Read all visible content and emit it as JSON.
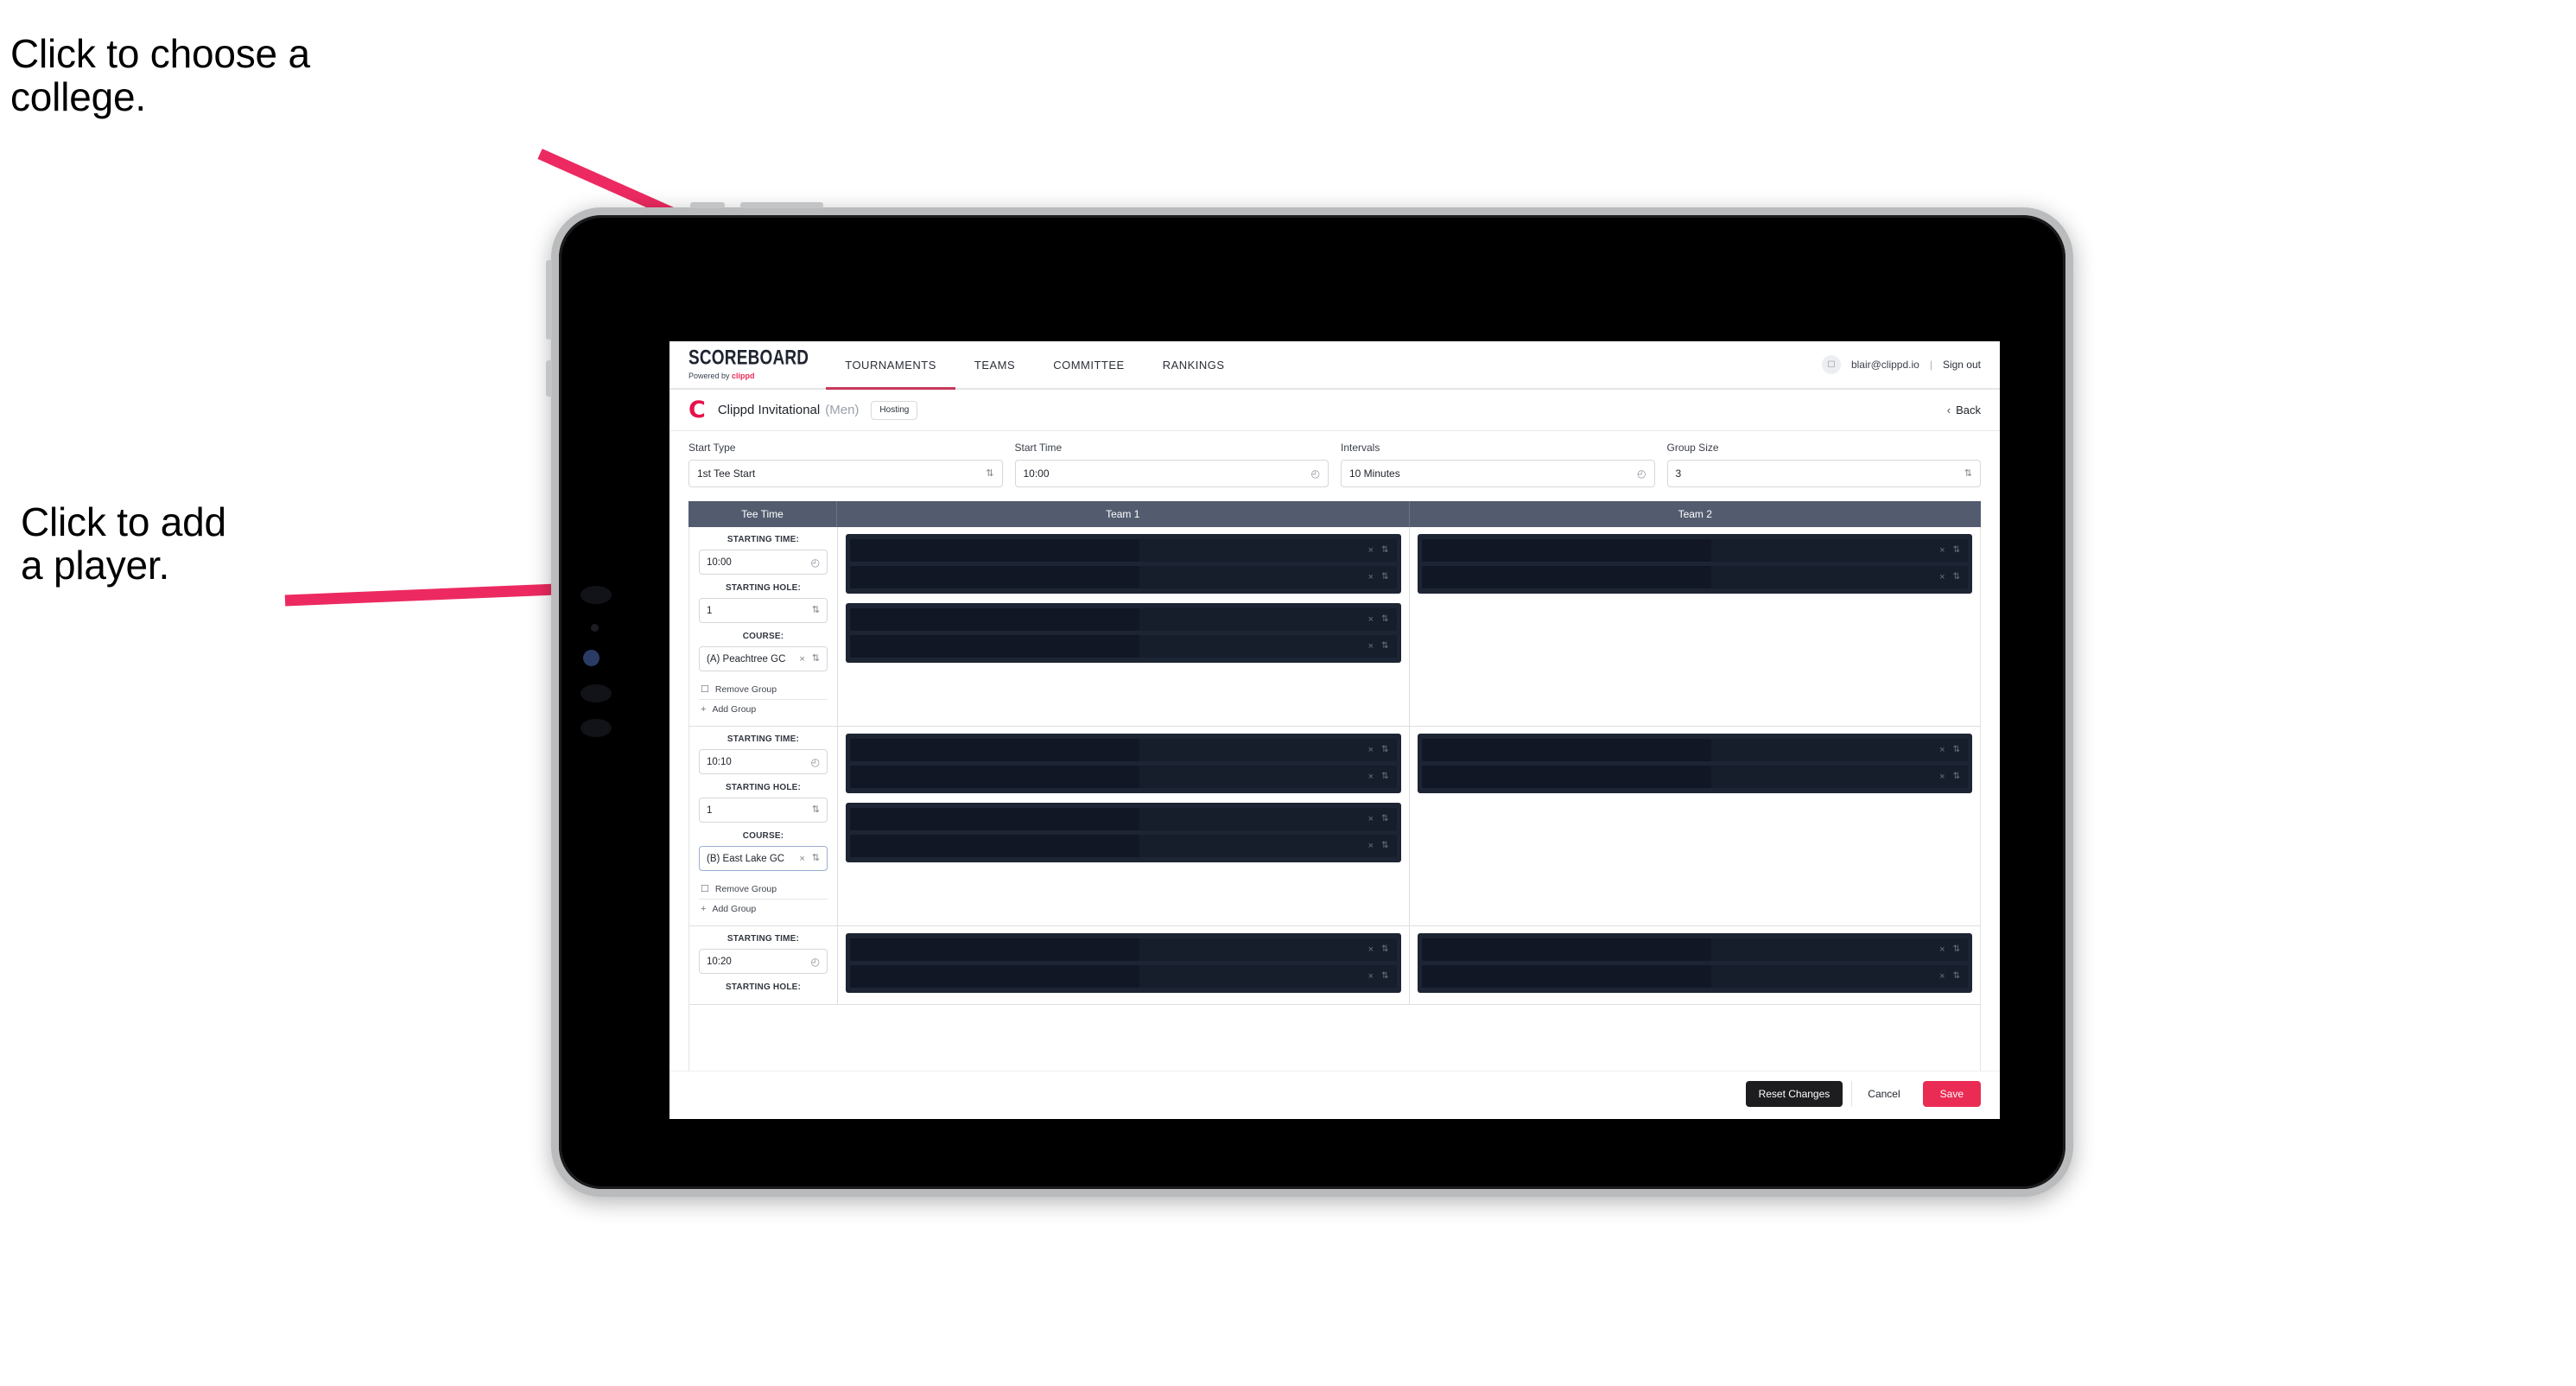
{
  "annotations": [
    {
      "id": "college",
      "text": "Click to choose a\ncollege."
    },
    {
      "id": "player",
      "text": "Click to add\na player."
    }
  ],
  "colors": {
    "accent_pink": "#ea2c55",
    "arrow_pink": "#ec2a61",
    "nav_underline": "#c8395c",
    "table_header_bg": "#535c6f",
    "player_block_bg": "#1d2534",
    "dark_button": "#1d1d20"
  },
  "topnav": {
    "brand_title": "SCOREBOARD",
    "brand_sub_prefix": "Powered by ",
    "brand_sub_name": "clippd",
    "tabs": [
      {
        "label": "TOURNAMENTS",
        "active": true
      },
      {
        "label": "TEAMS",
        "active": false
      },
      {
        "label": "COMMITTEE",
        "active": false
      },
      {
        "label": "RANKINGS",
        "active": false
      }
    ],
    "avatar_icon": "user-avatar-icon",
    "user_email": "blair@clippd.io",
    "separator": "|",
    "sign_out": "Sign out"
  },
  "breadcrumb": {
    "logo_letter": "C",
    "tournament_name": "Clippd Invitational",
    "gender": "(Men)",
    "badge": "Hosting",
    "back_chevron": "‹",
    "back_label": "Back"
  },
  "settings": {
    "fields": [
      {
        "label": "Start Type",
        "value": "1st Tee Start",
        "icon": "stepper",
        "icon_glyph": "⇅"
      },
      {
        "label": "Start Time",
        "value": "10:00",
        "icon": "clock",
        "icon_glyph": "◴"
      },
      {
        "label": "Intervals",
        "value": "10 Minutes",
        "icon": "clock",
        "icon_glyph": "◴"
      },
      {
        "label": "Group Size",
        "value": "3",
        "icon": "stepper",
        "icon_glyph": "⇅"
      }
    ]
  },
  "table": {
    "headers": {
      "tee_time": "Tee Time",
      "team1": "Team 1",
      "team2": "Team 2"
    },
    "labels": {
      "starting_time": "STARTING TIME:",
      "starting_hole": "STARTING HOLE:",
      "course": "COURSE:",
      "remove_group": "Remove Group",
      "add_group": "Add Group",
      "remove_icon": "trash-icon",
      "add_icon": "plus-icon",
      "clear_glyph": "×",
      "stepper_glyph": "⇅",
      "clock_glyph": "◴",
      "trash_glyph": "☐",
      "plus_glyph": "+"
    },
    "rows": [
      {
        "starting_time": "10:00",
        "starting_hole": "1",
        "course": "(A) Peachtree GC",
        "course_focused": false,
        "partial": false,
        "team1_blocks": [
          {
            "slots": [
              {
                "redacted": true
              },
              {
                "redacted": true
              }
            ]
          },
          {
            "slots": [
              {
                "redacted": true
              },
              {
                "redacted": true
              }
            ]
          }
        ],
        "team2_blocks": [
          {
            "slots": [
              {
                "redacted": true
              },
              {
                "redacted": true
              }
            ]
          }
        ]
      },
      {
        "starting_time": "10:10",
        "starting_hole": "1",
        "course": "(B) East Lake GC",
        "course_focused": true,
        "partial": false,
        "team1_blocks": [
          {
            "slots": [
              {
                "redacted": true
              },
              {
                "redacted": true
              }
            ]
          },
          {
            "slots": [
              {
                "redacted": true
              },
              {
                "redacted": true
              }
            ]
          }
        ],
        "team2_blocks": [
          {
            "slots": [
              {
                "redacted": true
              },
              {
                "redacted": true
              }
            ]
          }
        ]
      },
      {
        "starting_time": "10:20",
        "starting_hole": "",
        "course": "",
        "course_focused": false,
        "partial": true,
        "team1_blocks": [
          {
            "slots": [
              {
                "redacted": true
              },
              {
                "redacted": true
              }
            ]
          }
        ],
        "team2_blocks": [
          {
            "slots": [
              {
                "redacted": true
              },
              {
                "redacted": true
              }
            ]
          }
        ]
      }
    ]
  },
  "footer": {
    "reset": "Reset Changes",
    "cancel": "Cancel",
    "save": "Save"
  }
}
